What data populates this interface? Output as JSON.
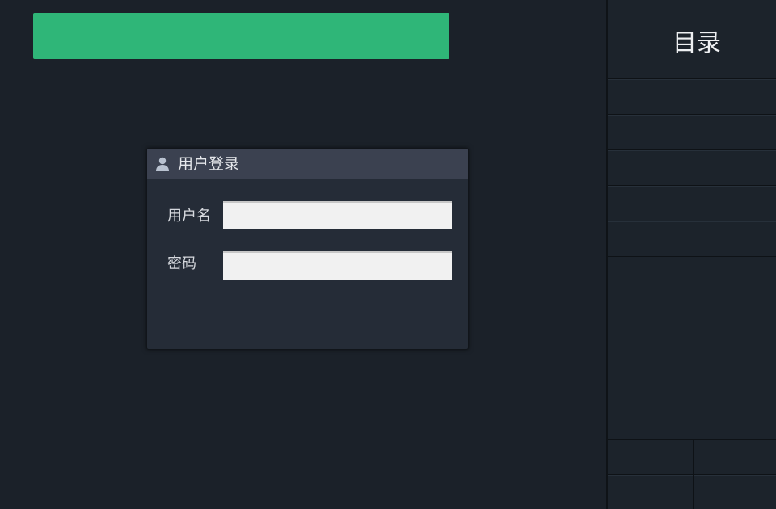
{
  "top_bar": {
    "color": "#2fb678"
  },
  "login_panel": {
    "title": "用户登录",
    "icon": "user-icon",
    "username_label": "用户名",
    "username_value": "",
    "password_label": "密码",
    "password_value": ""
  },
  "catalog": {
    "title": "目录"
  },
  "colors": {
    "background": "#1b2129",
    "panel": "#252c37",
    "panel_header": "#3b4150",
    "accent": "#2fb678",
    "input": "#f1f1f1"
  }
}
